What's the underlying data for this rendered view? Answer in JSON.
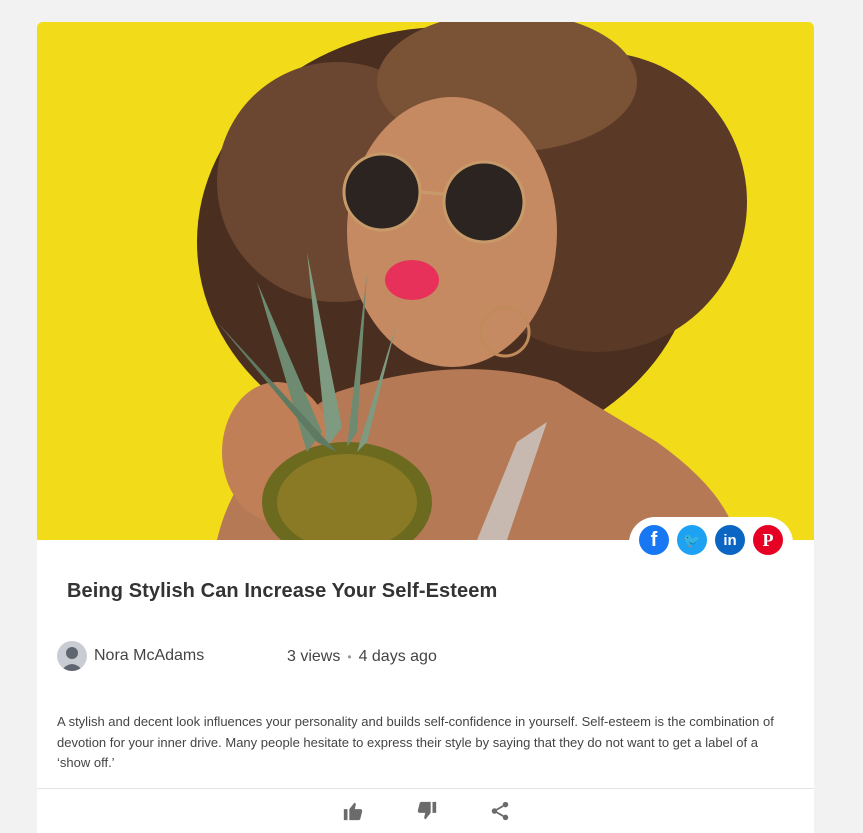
{
  "article": {
    "title": "Being Stylish Can Increase Your Self-Esteem",
    "author": "Nora McAdams",
    "views": "3 views",
    "separator": "•",
    "posted": "4 days ago",
    "excerpt": "A stylish and decent look influences your personality and builds self-confidence in yourself. Self-esteem is the combination of devotion for your inner drive. Many people hesitate to express their style by saying that they do not want to get a label of a ‘show off.’"
  },
  "share": {
    "facebook": {
      "glyph": "f",
      "color": "#1877f2",
      "icon": "facebook-icon"
    },
    "twitter": {
      "glyph": "🐦",
      "color": "#1da1f2",
      "icon": "twitter-icon"
    },
    "linkedin": {
      "glyph": "in",
      "color": "#0a66c2",
      "icon": "linkedin-icon"
    },
    "pinterest": {
      "glyph": "P",
      "color": "#e60023",
      "icon": "pinterest-icon"
    }
  },
  "actions": {
    "like": {
      "icon": "thumbs-up-icon"
    },
    "dislike": {
      "icon": "thumbs-down-icon"
    },
    "share": {
      "icon": "share-icon"
    }
  },
  "colors": {
    "hero_background": "#f2dc1a",
    "text": "#444444",
    "title": "#333333"
  }
}
